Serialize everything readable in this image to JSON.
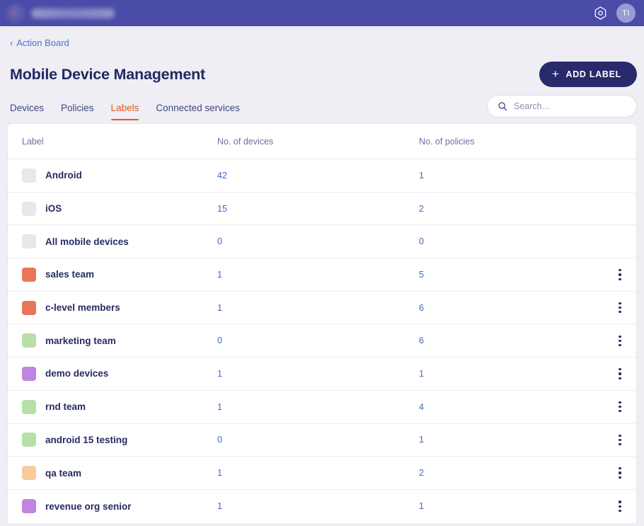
{
  "topbar": {
    "brand_name": "",
    "settings_icon": "hexagon-gear-icon",
    "avatar_initials": "TI",
    "background_color": "#4a4ca8"
  },
  "breadcrumb": {
    "back_icon": "chevron-left-icon",
    "label": "Action Board"
  },
  "header": {
    "title": "Mobile Device Management",
    "add_button_label": "ADD LABEL",
    "add_button_icon": "plus-icon",
    "add_button_color": "#282a6b"
  },
  "tabs": [
    {
      "label": "Devices",
      "active": false
    },
    {
      "label": "Policies",
      "active": false
    },
    {
      "label": "Labels",
      "active": true
    },
    {
      "label": "Connected services",
      "active": false
    }
  ],
  "tabs_accent_color": "#e8591f",
  "search": {
    "icon": "search-icon",
    "value": "",
    "placeholder": "Search..."
  },
  "table": {
    "columns": [
      "Label",
      "No. of devices",
      "No. of policies"
    ],
    "row_menu_icon": "kebab-menu-icon",
    "rows": [
      {
        "swatch_color": "#e8e8ec",
        "label": "Android",
        "devices": "42",
        "policies": "1",
        "has_menu": false
      },
      {
        "swatch_color": "#e8e8ec",
        "label": "iOS",
        "devices": "15",
        "policies": "2",
        "has_menu": false
      },
      {
        "swatch_color": "#e8e8ec",
        "label": "All mobile devices",
        "devices": "0",
        "policies": "0",
        "has_menu": false
      },
      {
        "swatch_color": "#e8765b",
        "label": "sales team",
        "devices": "1",
        "policies": "5",
        "has_menu": true
      },
      {
        "swatch_color": "#e8765b",
        "label": "c-level members",
        "devices": "1",
        "policies": "6",
        "has_menu": true
      },
      {
        "swatch_color": "#b8dfa8",
        "label": "marketing team",
        "devices": "0",
        "policies": "6",
        "has_menu": true
      },
      {
        "swatch_color": "#c085e0",
        "label": "demo devices",
        "devices": "1",
        "policies": "1",
        "has_menu": true
      },
      {
        "swatch_color": "#b8dfa8",
        "label": "rnd team",
        "devices": "1",
        "policies": "4",
        "has_menu": true
      },
      {
        "swatch_color": "#b8dfa8",
        "label": "android 15 testing",
        "devices": "0",
        "policies": "1",
        "has_menu": true
      },
      {
        "swatch_color": "#f9cb9c",
        "label": "qa team",
        "devices": "1",
        "policies": "2",
        "has_menu": true
      },
      {
        "swatch_color": "#c085e0",
        "label": "revenue org senior",
        "devices": "1",
        "policies": "1",
        "has_menu": true
      }
    ]
  }
}
